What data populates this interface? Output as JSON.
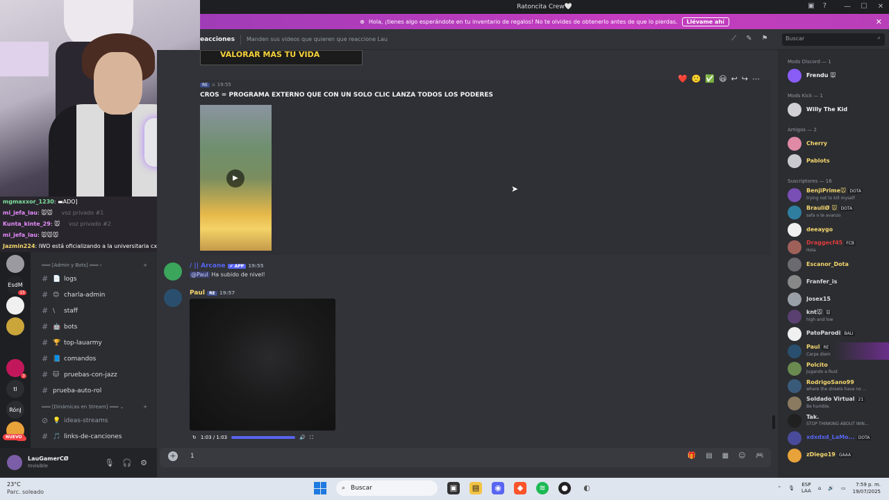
{
  "window": {
    "title": "Ratoncita Crew🤍",
    "controls": [
      "—",
      "☐",
      "✕"
    ]
  },
  "banner": {
    "text": "Hola, ¡tienes algo esperándote en tu inventario de regalos! No te olvides de obtenerlo antes de que lo pierdas.",
    "cta": "Llévame ahí"
  },
  "channel_header": {
    "name": "eacciones",
    "topic": "Manden sus videos que quieren que reaccione Lau",
    "search_placeholder": "Buscar"
  },
  "stream_chat": [
    {
      "user": "mgmaxxor_1230",
      "text": ": ▬ADO]"
    },
    {
      "user": "mi_jefa_lau",
      "text": ": 🐭🐭"
    },
    {
      "user": "Kunta_kinte_29",
      "text": ": 🐭"
    },
    {
      "user": "mi_jefa_lau",
      "text": ": 🐭🐭🐭"
    },
    {
      "user": "Jazmin224",
      "text": ": IWO está oficializando a la universitaria cx"
    }
  ],
  "servers": [
    {
      "label": "",
      "badge": ""
    },
    {
      "label": "EsdM",
      "badge": "15"
    },
    {
      "label": "",
      "badge": ""
    },
    {
      "label": "",
      "badge": ""
    },
    {
      "label": "",
      "badge": ""
    },
    {
      "label": "",
      "badge": "3"
    },
    {
      "label": "tl",
      "badge": ""
    },
    {
      "label": "RónJ",
      "badge": ""
    },
    {
      "label": "",
      "badge": "415"
    }
  ],
  "rail_new_label": "NUEVO",
  "channels": {
    "faded_voice": [
      "voz privado #1",
      "voz privado #2"
    ],
    "category_admin": "[Admin y Bots]",
    "items_admin": [
      {
        "emoji": "📄",
        "name": "logs"
      },
      {
        "emoji": "😊",
        "name": "charla-admin"
      },
      {
        "emoji": "\\",
        "name": "staff"
      },
      {
        "emoji": "🤖",
        "name": "bots"
      },
      {
        "emoji": "🏆",
        "name": "top-lauarmy"
      },
      {
        "emoji": "📘",
        "name": "comandos"
      },
      {
        "emoji": "🐱",
        "name": "pruebas-con-jazz"
      },
      {
        "emoji": "",
        "name": "prueba-auto-rol"
      }
    ],
    "category_dyn": "[Dinámicas en Stream]",
    "items_dyn": [
      {
        "emoji": "💡",
        "name": "ideas-streams"
      },
      {
        "emoji": "🎵",
        "name": "links-de-canciones"
      }
    ]
  },
  "user_panel": {
    "name": "LauGamerCØ",
    "status": "Invisible"
  },
  "messages": {
    "top_image_text": "VALORAR MAS TU VIDA",
    "msg1": {
      "badge": "RE",
      "time": "19:55",
      "text": "CROS = PROGRAMA EXTERNO QUE CON UN SOLO CLIC LANZA TODOS LOS PODERES"
    },
    "reactions": [
      "❤️",
      "🙂",
      "✅",
      "😃",
      "↩",
      "↪",
      "⋯"
    ],
    "msg2": {
      "author": "/ || Arcane",
      "tag": "✔ APP",
      "time": "19:55",
      "mention": "@Paul",
      "text": "Ha subido de nivel!"
    },
    "msg3": {
      "author": "Paul",
      "badge": "RE",
      "time": "19:57",
      "video_time": "1:03 / 1:03"
    }
  },
  "composer": {
    "value": "1"
  },
  "members": {
    "groups": [
      {
        "title": "Mods Discord — 1",
        "members": [
          {
            "name": "Frendu 🐭",
            "sub": "",
            "tag": "",
            "color": "#f2f3f5"
          }
        ]
      },
      {
        "title": "Mods Kick — 1",
        "members": [
          {
            "name": "Willy The Kid",
            "sub": "",
            "tag": "",
            "color": "#f2f3f5"
          }
        ]
      },
      {
        "title": "Amigos — 2",
        "members": [
          {
            "name": "Cherry",
            "sub": "",
            "tag": "",
            "color": "#f5d76e"
          },
          {
            "name": "Pablots",
            "sub": "",
            "tag": "",
            "color": "#f5d76e"
          }
        ]
      },
      {
        "title": "Suscriptores — 16",
        "members": [
          {
            "name": "BenjiPrime🐭",
            "sub": "trying not to kill myself",
            "tag": "DOTA",
            "color": "#f5d76e"
          },
          {
            "name": "BrauliØ 🐭",
            "sub": "safa o te avanzo",
            "tag": "DOTA",
            "color": "#f5d76e"
          },
          {
            "name": "deeaygo",
            "sub": "",
            "tag": "",
            "color": "#f5d76e"
          },
          {
            "name": "Draggecf45",
            "sub": "Hola",
            "tag": "FCB",
            "color": "#e03c3c"
          },
          {
            "name": "Escanor_Dota",
            "sub": "",
            "tag": "",
            "color": "#f5d76e"
          },
          {
            "name": "Franfer_is",
            "sub": "",
            "tag": "",
            "color": "#dbdee1"
          },
          {
            "name": "Josex15",
            "sub": "",
            "tag": "",
            "color": "#dbdee1"
          },
          {
            "name": "knt🐭",
            "sub": "high and low",
            "tag": "🐭",
            "color": "#dbdee1"
          },
          {
            "name": "PatoParodi",
            "sub": "",
            "tag": "BALI",
            "color": "#dbdee1"
          },
          {
            "name": "Paul",
            "sub": "Carpe diem",
            "tag": "RE",
            "color": "#f5d76e"
          },
          {
            "name": "Polcito",
            "sub": "Jugando a Rust",
            "tag": "",
            "color": "#f5d76e"
          },
          {
            "name": "RodrigoSano99",
            "sub": "where the streets have no ...",
            "tag": "",
            "color": "#f5d76e"
          },
          {
            "name": "Soldado Virtual",
            "sub": "Be humble.",
            "tag": "21",
            "color": "#dbdee1"
          },
          {
            "name": "Tak.",
            "sub": "STOP THINKING ABOUT WIN...",
            "tag": "",
            "color": "#dbdee1"
          },
          {
            "name": "xdxdxd_LaMo...",
            "sub": "",
            "tag": "DOTA",
            "color": "#5865f2"
          },
          {
            "name": "zDiego19",
            "sub": "",
            "tag": "GAAA",
            "color": "#f5d76e"
          }
        ]
      }
    ]
  },
  "taskbar": {
    "temp": "23°C",
    "condition": "Parc. soleado",
    "search": "Buscar",
    "lang": "ESP",
    "lang2": "LAA",
    "time": "7:59 p. m.",
    "date": "19/07/2025"
  },
  "colors": {
    "accent": "#5865f2",
    "banner": "#c53cc0",
    "bg": "#313338"
  }
}
